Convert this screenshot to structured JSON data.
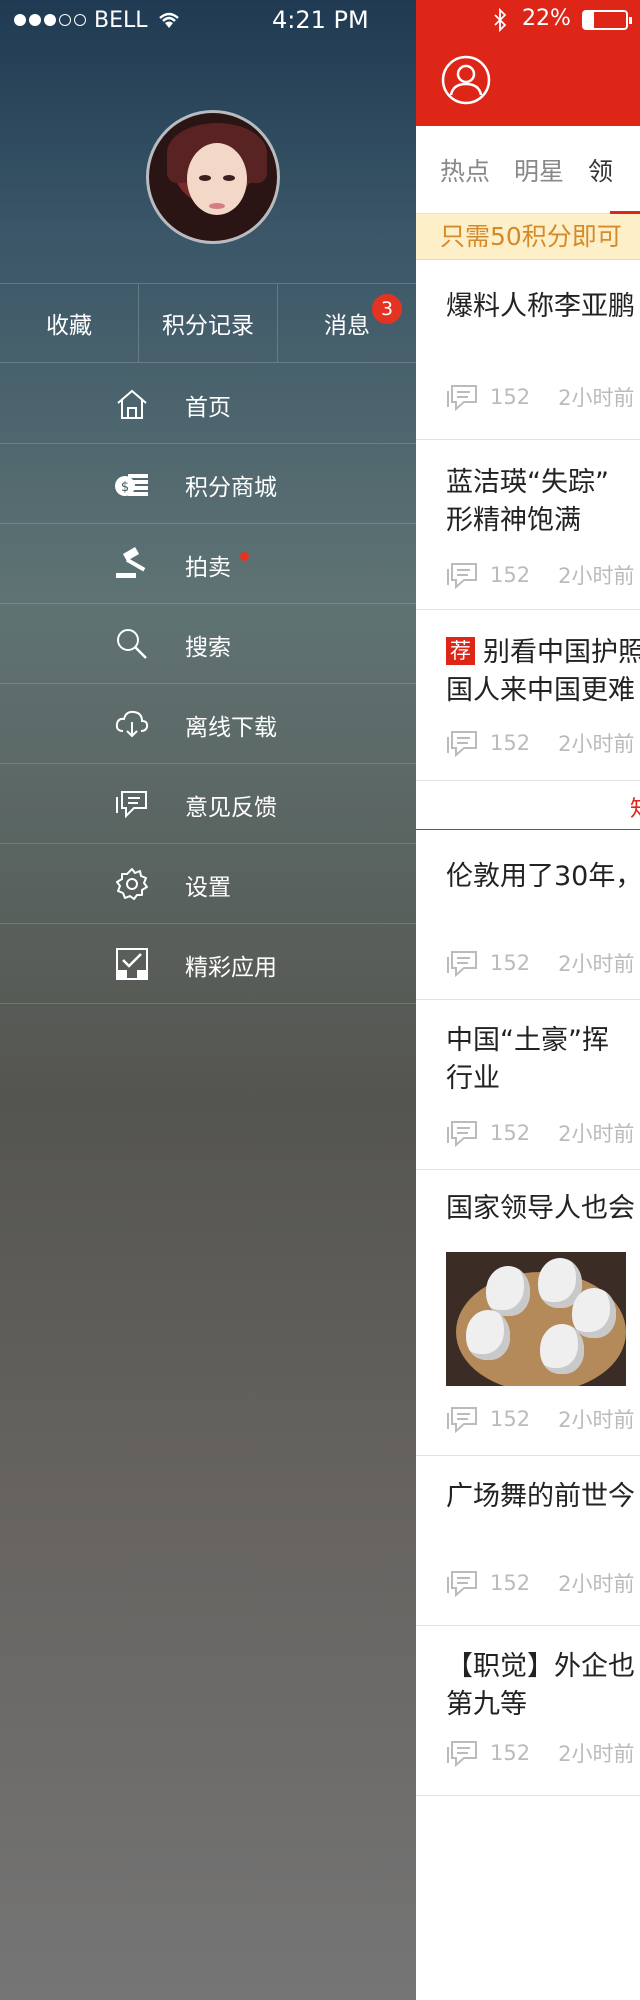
{
  "status_bar": {
    "carrier": "BELL",
    "time": "4:21 PM",
    "battery": "22%"
  },
  "drawer": {
    "quick_actions": [
      {
        "label": "收藏"
      },
      {
        "label": "积分记录"
      },
      {
        "label": "消息",
        "badge": "3"
      }
    ],
    "menu": [
      {
        "label": "首页",
        "icon": "home-icon"
      },
      {
        "label": "积分商城",
        "icon": "coins-icon"
      },
      {
        "label": "拍卖",
        "icon": "gavel-icon",
        "dot": true
      },
      {
        "label": "搜索",
        "icon": "search-icon"
      },
      {
        "label": "离线下载",
        "icon": "cloud-download-icon"
      },
      {
        "label": "意见反馈",
        "icon": "feedback-icon"
      },
      {
        "label": "设置",
        "icon": "gear-icon"
      },
      {
        "label": "精彩应用",
        "icon": "apps-icon"
      }
    ]
  },
  "content": {
    "tabs": [
      "热点",
      "明星",
      "领"
    ],
    "promo": "只需50积分即可",
    "news": [
      {
        "title": "爆料人称李亚鹏",
        "comments": "152",
        "time": "2小时前"
      },
      {
        "title1": "蓝洁瑛“失踪”",
        "title2": "形精神饱满",
        "comments": "152",
        "time": "2小时前"
      },
      {
        "tag": "荐",
        "title1": "别看中国护照",
        "title2": "国人来中国更难",
        "comments": "152",
        "time": "2小时前"
      },
      {
        "divider": "知"
      },
      {
        "title": "伦敦用了30年，",
        "comments": "152",
        "time": "2小时前"
      },
      {
        "title1": "中国“土豪”挥",
        "title2": "行业",
        "comments": "152",
        "time": "2小时前"
      },
      {
        "title": "国家领导人也会",
        "comments": "152",
        "time": "2小时前"
      },
      {
        "title": "广场舞的前世今",
        "comments": "152",
        "time": "2小时前"
      },
      {
        "title1": "【职觉】外企也",
        "title2": "第九等",
        "comments": "152",
        "time": "2小时前"
      }
    ]
  },
  "colors": {
    "brand_red": "#dd2518",
    "badge_red": "#e53322",
    "promo_bg": "#fdf0c9",
    "promo_text": "#d58a2a"
  }
}
